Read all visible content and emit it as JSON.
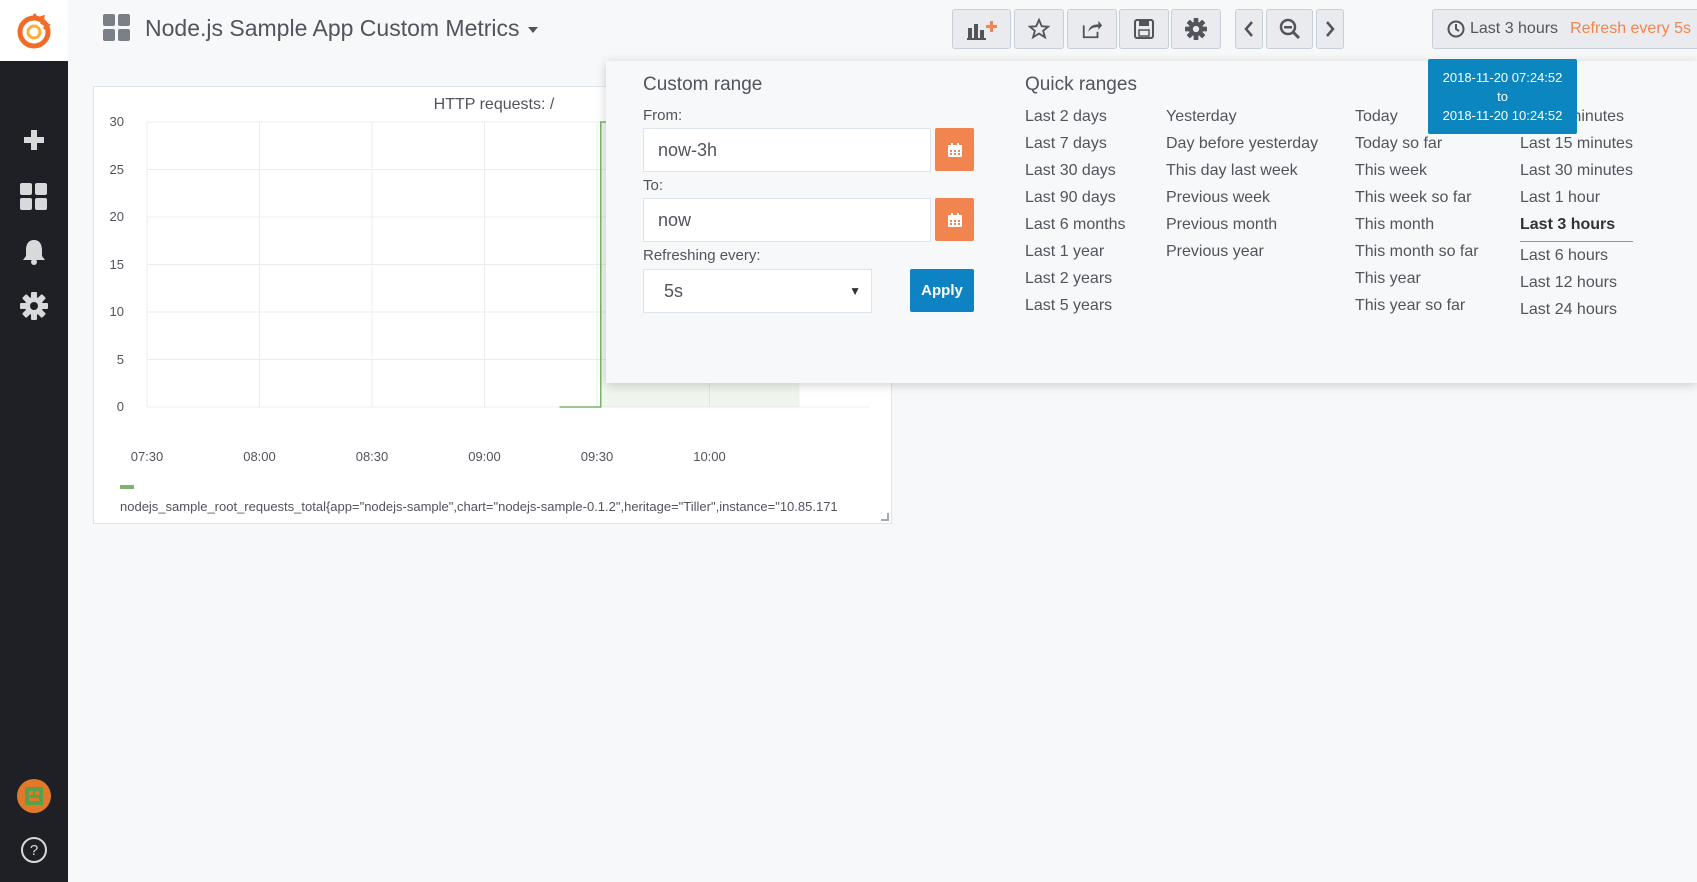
{
  "dashboard": {
    "title": "Node.js Sample App Custom Metrics"
  },
  "time_picker": {
    "label": "Last 3 hours",
    "refresh_label": "Refresh every 5s"
  },
  "tooltip": {
    "from": "2018-11-20 07:24:52",
    "sep": "to",
    "to": "2018-11-20 10:24:52"
  },
  "panel": {
    "title": "HTTP requests: /",
    "legend": "nodejs_sample_root_requests_total{app=\"nodejs-sample\",chart=\"nodejs-sample-0.1.2\",heritage=\"Tiller\",instance=\"10.85.171"
  },
  "chart_data": {
    "type": "area",
    "title": "HTTP requests: /",
    "ylim": [
      0,
      30
    ],
    "yticks": [
      "0",
      "5",
      "10",
      "15",
      "20",
      "25",
      "30"
    ],
    "xticks": [
      "07:30",
      "08:00",
      "08:30",
      "09:00",
      "09:30",
      "10:00"
    ],
    "grid": true,
    "legend_position": "bottom",
    "series": [
      {
        "name": "nodejs_sample_root_requests_total{app=\"nodejs-sample\",chart=\"nodejs-sample-0.1.2\",heritage=\"Tiller\",instance=\"10.85.171",
        "color": "#7eb26d",
        "x": [
          "09:20",
          "09:31",
          "09:31",
          "10:24"
        ],
        "y": [
          0,
          0,
          30,
          30
        ]
      }
    ]
  },
  "custom_range": {
    "title": "Custom range",
    "from_label": "From:",
    "from_value": "now-3h",
    "to_label": "To:",
    "to_value": "now",
    "refresh_label": "Refreshing every:",
    "refresh_value": "5s",
    "apply_label": "Apply"
  },
  "quick_ranges": {
    "title": "Quick ranges",
    "col1": [
      "Last 2 days",
      "Last 7 days",
      "Last 30 days",
      "Last 90 days",
      "Last 6 months",
      "Last 1 year",
      "Last 2 years",
      "Last 5 years"
    ],
    "col2": [
      "Yesterday",
      "Day before yesterday",
      "This day last week",
      "Previous week",
      "Previous month",
      "Previous year"
    ],
    "col3": [
      "Today",
      "Today so far",
      "This week",
      "This week so far",
      "This month",
      "This month so far",
      "This year",
      "This year so far"
    ],
    "col4": [
      "Last 5 minutes",
      "Last 15 minutes",
      "Last 30 minutes",
      "Last 1 hour",
      "Last 3 hours",
      "Last 6 hours",
      "Last 12 hours",
      "Last 24 hours"
    ],
    "active": "Last 3 hours"
  },
  "colors": {
    "accent_orange": "#f1844f",
    "primary_blue": "#0d83c4",
    "series_green": "#7eb26d",
    "sidebar_bg": "#1f1f26"
  },
  "icons": {
    "sidebar": [
      "grafana-logo-icon",
      "plus-icon",
      "dashboards-icon",
      "bell-icon",
      "gear-icon",
      "avatar",
      "help-icon"
    ],
    "toolbar": [
      "add-panel-icon",
      "star-icon",
      "share-icon",
      "save-icon",
      "settings-icon",
      "chevron-left-icon",
      "zoom-out-icon",
      "chevron-right-icon",
      "refresh-icon"
    ]
  }
}
